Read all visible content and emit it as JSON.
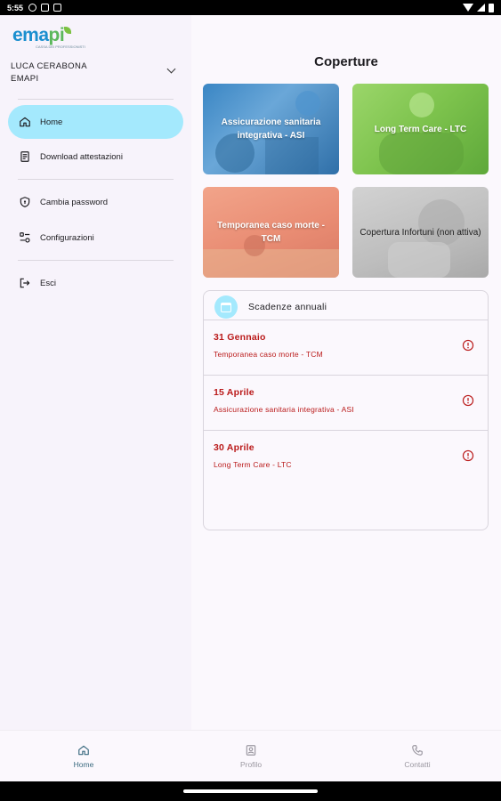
{
  "status_bar": {
    "time": "5:55"
  },
  "drawer": {
    "logo": {
      "wordmark_a": "ema",
      "wordmark_b": "pi",
      "tagline": "CASSA DEI PROFESSIONISTI"
    },
    "user": {
      "name": "LUCA CERABONA",
      "organization": "EMAPI"
    },
    "items": [
      {
        "label": "Home",
        "icon": "home-icon",
        "active": true
      },
      {
        "label": "Download attestazioni",
        "icon": "document-icon",
        "active": false
      },
      {
        "label": "Cambia password",
        "icon": "shield-icon",
        "active": false
      },
      {
        "label": "Configurazioni",
        "icon": "settings-icon",
        "active": false
      },
      {
        "label": "Esci",
        "icon": "logout-icon",
        "active": false
      }
    ]
  },
  "main": {
    "title": "Coperture",
    "cards": [
      {
        "label": "Assicurazione sanitaria integrativa - ASI",
        "color": "#3a86c4"
      },
      {
        "label": "Long Term Care - LTC",
        "color": "#7cc24c"
      },
      {
        "label": "Temporanea caso morte - TCM",
        "color": "#e98c73"
      },
      {
        "label": "Copertura Infortuni (non attiva)",
        "color": "#bdbdbd"
      }
    ],
    "deadlines": {
      "title": "Scadenze annuali",
      "items": [
        {
          "date": "31 Gennaio",
          "coverage": "Temporanea caso morte - TCM"
        },
        {
          "date": "15 Aprile",
          "coverage": "Assicurazione sanitaria integrativa - ASI"
        },
        {
          "date": "30 Aprile",
          "coverage": "Long Term Care - LTC"
        }
      ],
      "alert_color": "#ba1a1a"
    }
  },
  "bottom_nav": {
    "items": [
      {
        "label": "Home",
        "icon": "home-icon",
        "active": true
      },
      {
        "label": "Profilo",
        "icon": "profile-icon",
        "active": false
      },
      {
        "label": "Contatti",
        "icon": "phone-icon",
        "active": false
      }
    ]
  },
  "colors": {
    "accent": "#a4e9fd",
    "background": "#fbf8fd",
    "drawer": "#f7f3fb",
    "error": "#ba1a1a"
  }
}
